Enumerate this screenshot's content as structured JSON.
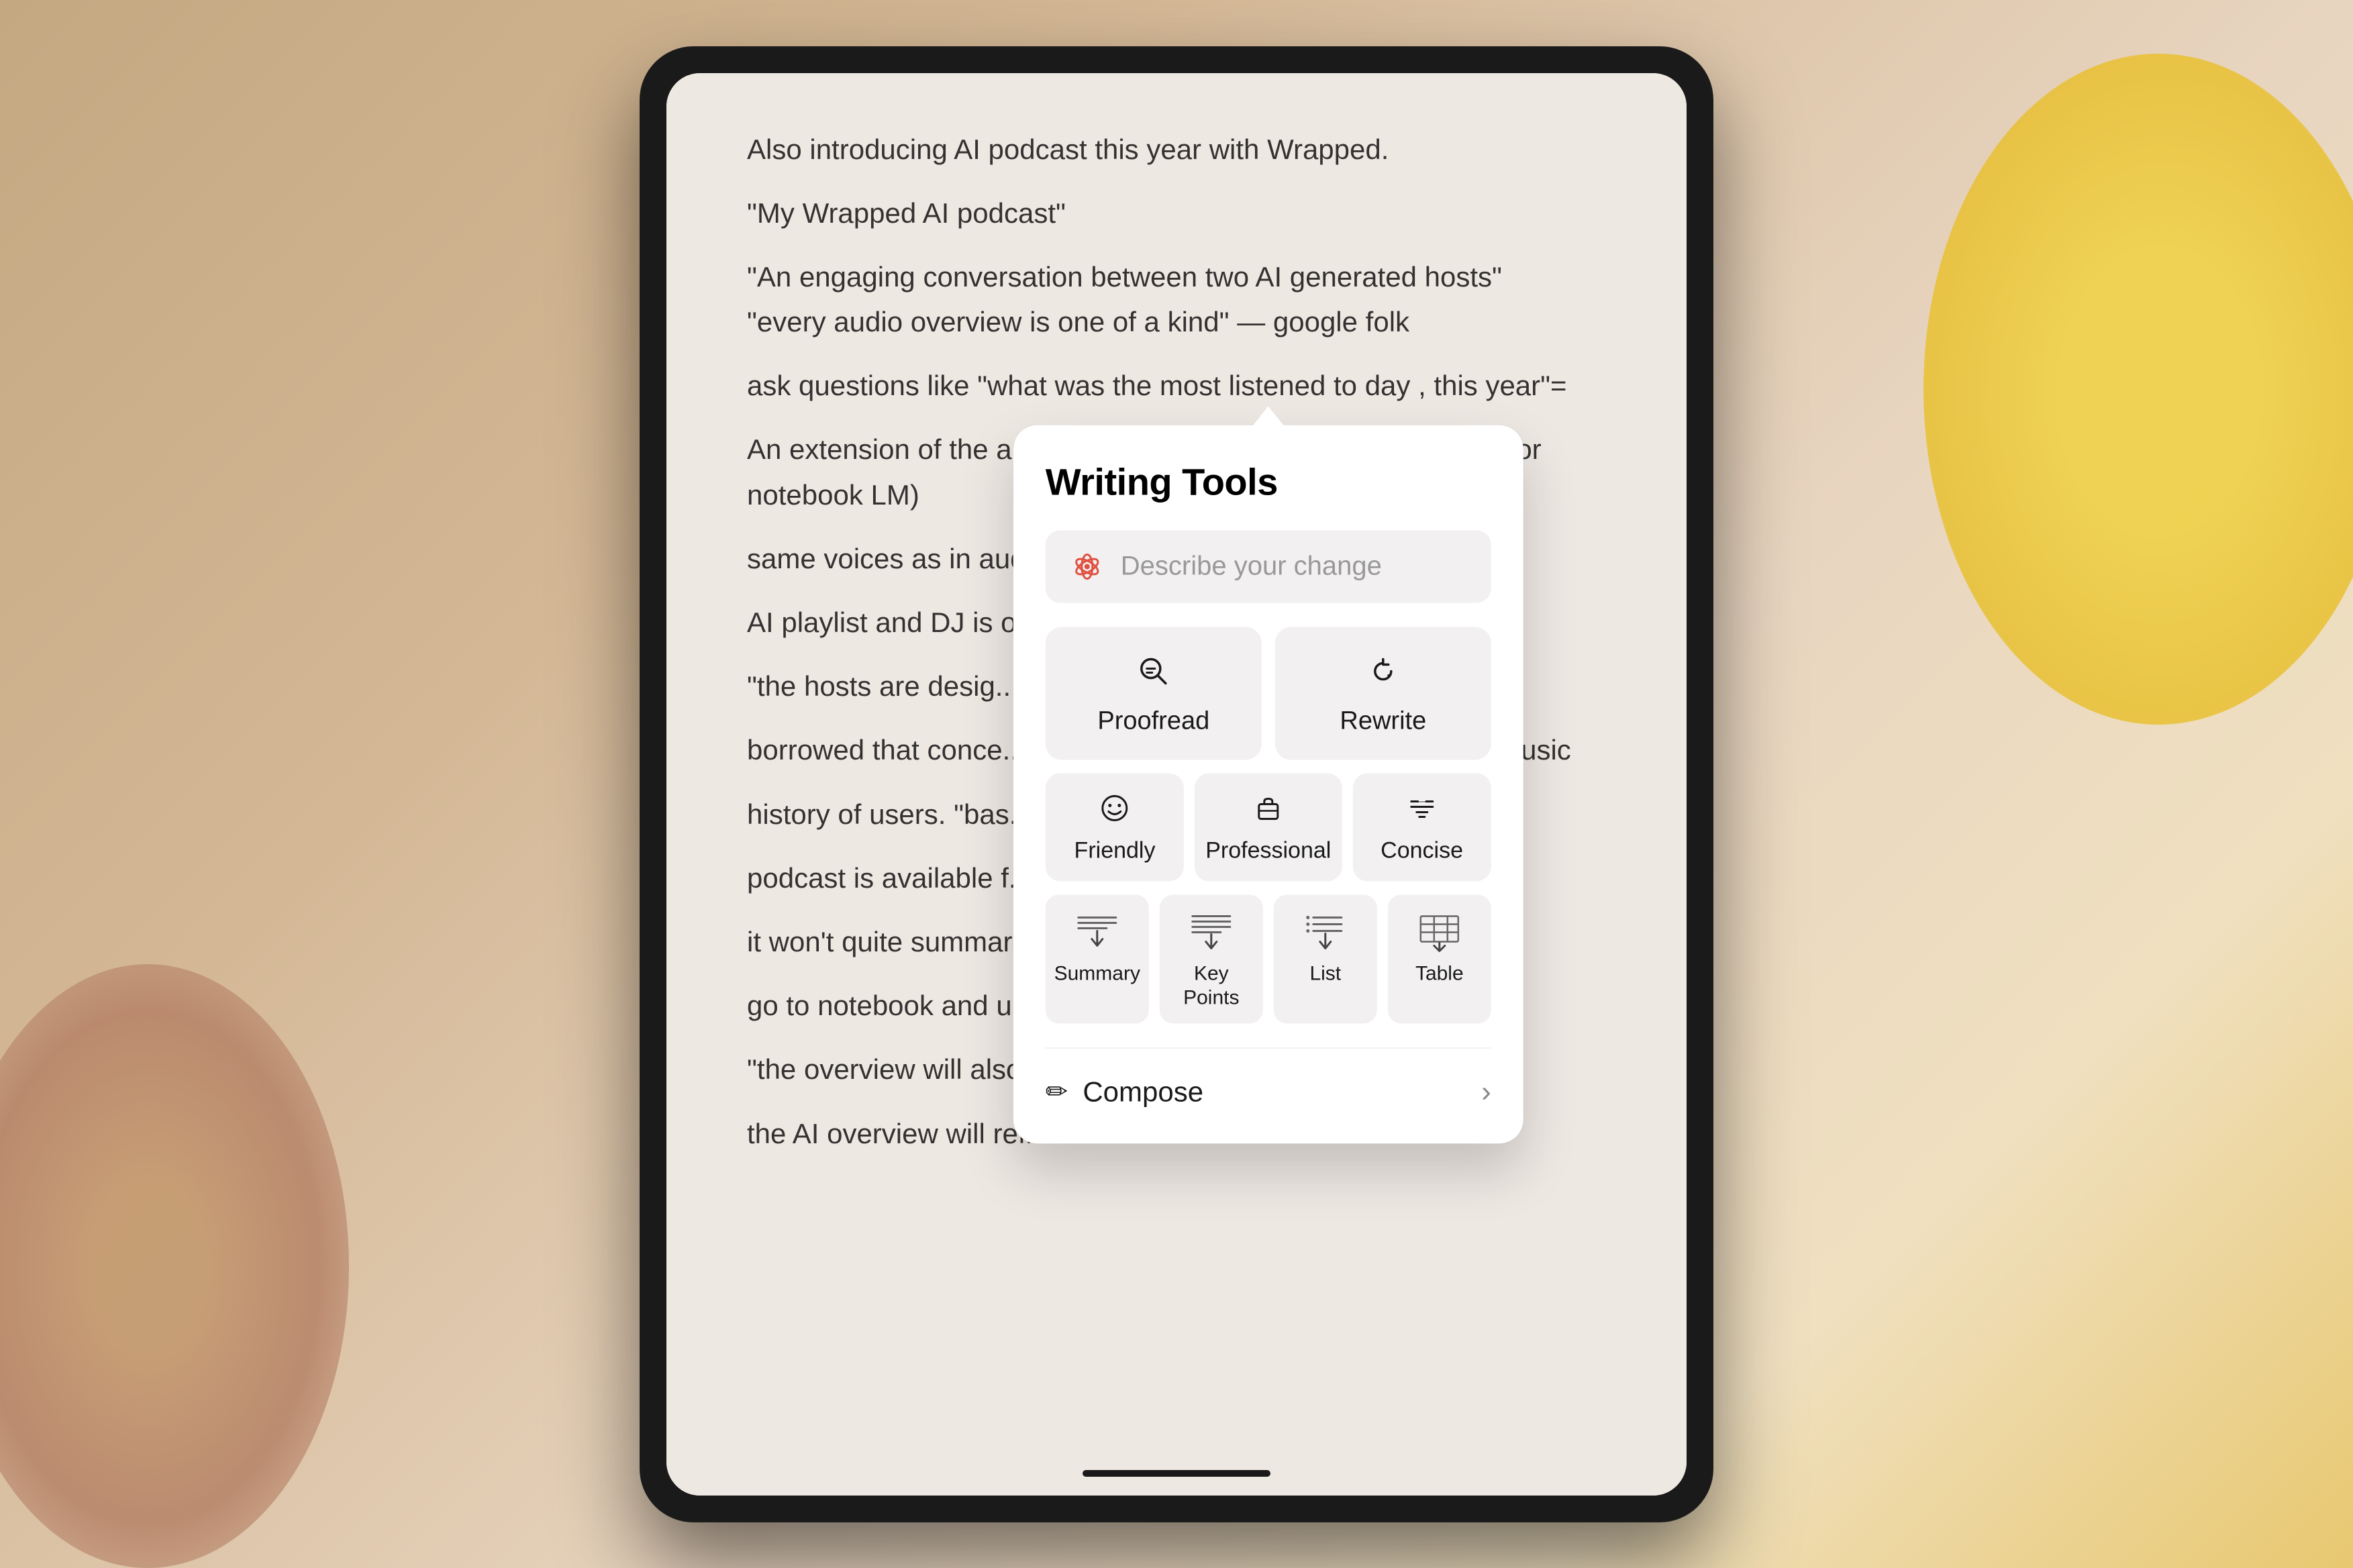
{
  "background": {
    "description": "tablet on desk with stuffed animals"
  },
  "document": {
    "lines": [
      "Also introducing AI podcast this year with Wrapped.",
      "\"My Wrapped AI podcast\"",
      "\"An engaging conversation between two AI generated hosts\"",
      "\"every audio overview is one of a kind\" — google folk",
      "ask questions like \"what was the most listened to day , this year\"=",
      "An extension of the audio overviews feature from google AI / (or notebook LM)",
      "same voices as in aud...",
      "AI playlist and DJ is o...",
      "\"the hosts are desig... s of information.",
      "borrowed that conce... ne priniciiple for music",
      "history of users. \"bas...",
      "podcast is available f...",
      "it won't quite summar... for that you need to",
      "go to notebook and u...",
      "\"the overview will also... nappropriate content,",
      "the AI overview will reflect it\""
    ]
  },
  "writing_tools": {
    "title": "Writing Tools",
    "describe_placeholder": "Describe your change",
    "buttons": {
      "proofread": {
        "label": "Proofread",
        "icon": "search-with-check"
      },
      "rewrite": {
        "label": "Rewrite",
        "icon": "refresh-arrow"
      },
      "friendly": {
        "label": "Friendly",
        "icon": "smiley"
      },
      "professional": {
        "label": "Professional",
        "icon": "briefcase"
      },
      "concise": {
        "label": "Concise",
        "icon": "lines-equals"
      },
      "summary": {
        "label": "Summary",
        "icon": "lines-arrow"
      },
      "key_points": {
        "label": "Key Points",
        "icon": "lines-arrow"
      },
      "list": {
        "label": "List",
        "icon": "lines-arrow"
      },
      "table": {
        "label": "Table",
        "icon": "table-grid"
      },
      "compose": {
        "label": "Compose",
        "icon": "pencil"
      }
    }
  }
}
